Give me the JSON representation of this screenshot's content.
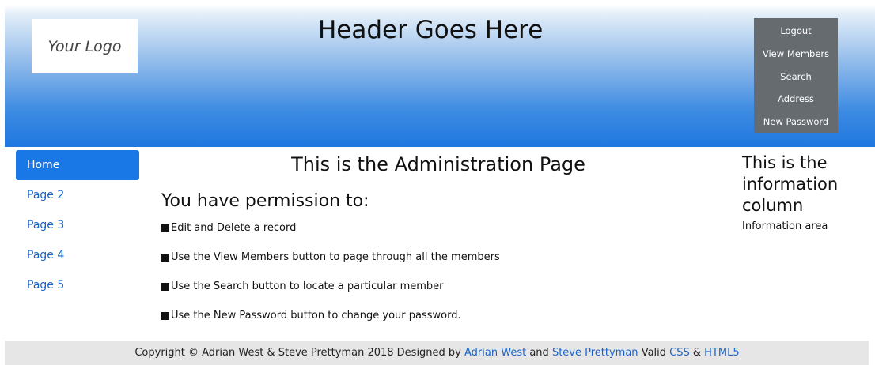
{
  "header": {
    "logo_text": "Your Logo",
    "title": "Header Goes Here",
    "menu": [
      "Logout",
      "View Members",
      "Search",
      "Address",
      "New Password"
    ]
  },
  "nav": [
    "Home",
    "Page 2",
    "Page 3",
    "Page 4",
    "Page 5"
  ],
  "main": {
    "heading": "This is the Administration Page",
    "subheading": "You have permission to:",
    "permissions": [
      "Edit and Delete a record",
      "Use the View Members button to page through all the members",
      "Use the Search button to locate a particular member",
      "Use the New Password button to change your password."
    ]
  },
  "info": {
    "heading": "This is the information column",
    "text": "Information area"
  },
  "footer": {
    "copyright": "Copyright © Adrian West & Steve Prettyman 2018 Designed by",
    "designer1": "Adrian West",
    "and": "and",
    "designer2": "Steve Prettyman",
    "valid": "Valid",
    "css": "CSS",
    "amp": "&",
    "html5": "HTML5"
  },
  "colors": {
    "header_gradient_top": "#ffffff",
    "header_gradient_bottom": "#1f77e0",
    "menu_bg": "#666b70",
    "active_nav": "#1a78e6",
    "link": "#1a64c8",
    "footer_bg": "#e6e6e6"
  }
}
